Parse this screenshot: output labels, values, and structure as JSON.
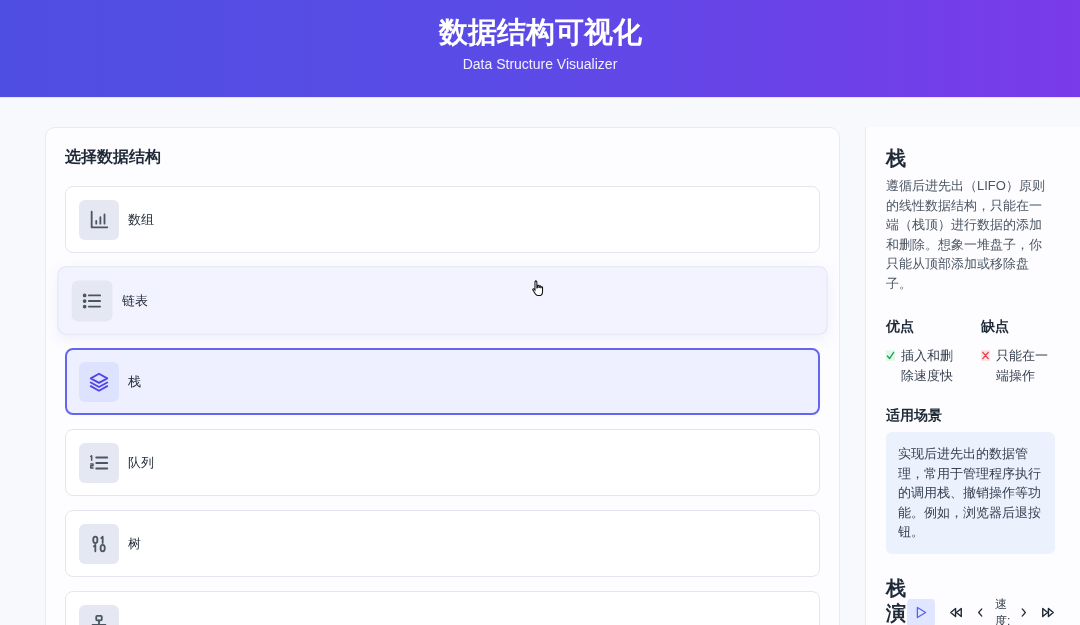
{
  "header": {
    "title": "数据结构可视化",
    "subtitle": "Data Structure Visualizer"
  },
  "structure_panel": {
    "title": "选择数据结构",
    "items": [
      {
        "label": "数组",
        "kind": "array",
        "selected": false,
        "hovered": false
      },
      {
        "label": "链表",
        "kind": "linked_list",
        "selected": false,
        "hovered": true
      },
      {
        "label": "栈",
        "kind": "stack",
        "selected": true,
        "hovered": false
      },
      {
        "label": "队列",
        "kind": "queue",
        "selected": false,
        "hovered": false
      },
      {
        "label": "树",
        "kind": "tree",
        "selected": false,
        "hovered": false
      },
      {
        "kind": "graph",
        "selected": false,
        "hovered": false
      }
    ]
  },
  "info_panel": {
    "title": "栈",
    "description": "遵循后进先出（LIFO）原则的线性数据结构，只能在一端（栈顶）进行数据的添加和删除。想象一堆盘子，你只能从顶部添加或移除盘子。",
    "pros": {
      "title": "优点",
      "items": [
        "插入和删除速度快"
      ]
    },
    "cons": {
      "title": "缺点",
      "items": [
        "只能在一端操作"
      ]
    },
    "use_cases": {
      "title": "适用场景",
      "text": "实现后进先出的数据管理，常用于管理程序执行的调用栈、撤销操作等功能。例如，浏览器后退按钮。"
    }
  },
  "demo": {
    "title": "栈演",
    "speed_label": "速度:"
  }
}
